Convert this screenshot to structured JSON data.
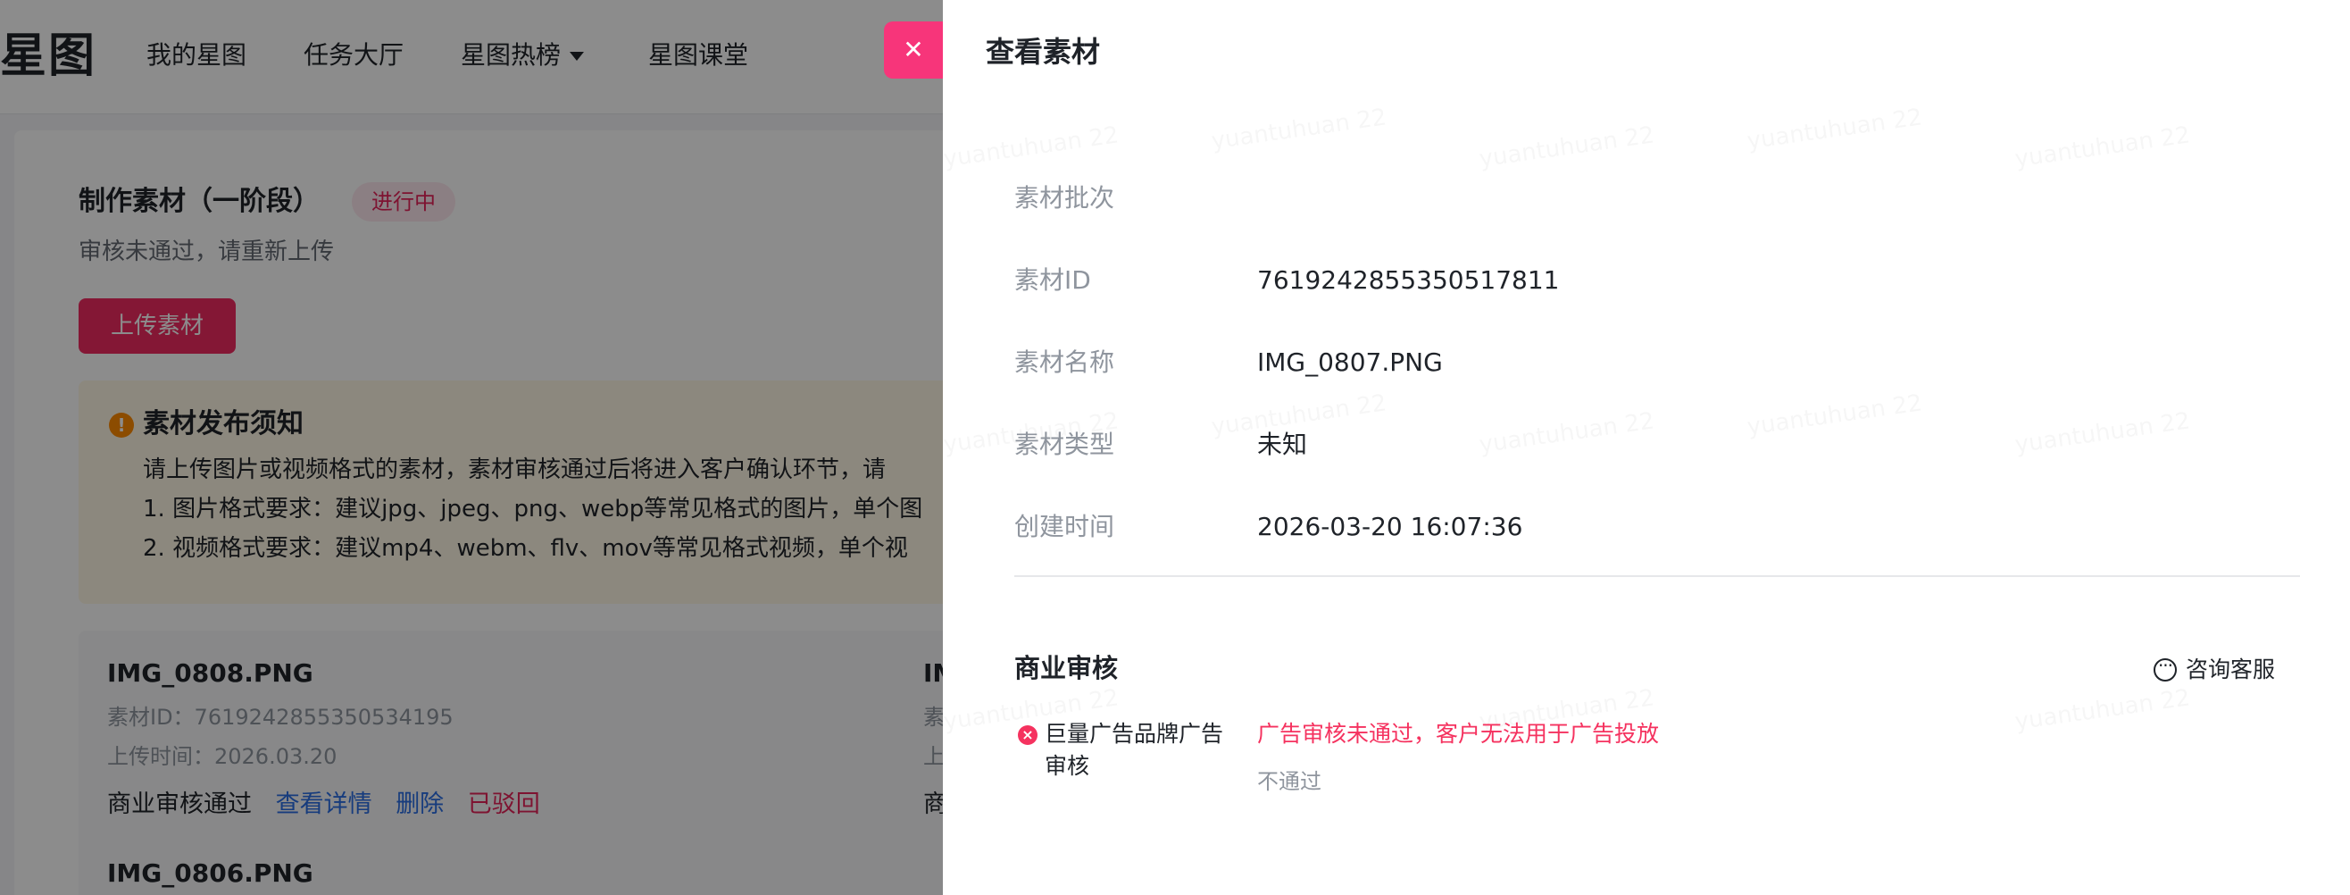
{
  "nav": {
    "logo": "星图",
    "items": [
      "我的星图",
      "任务大厅",
      "星图热榜",
      "星图课堂"
    ]
  },
  "stage": {
    "title": "制作素材（一阶段）",
    "status": "进行中",
    "subtitle": "审核未通过，请重新上传",
    "upload_button": "上传素材"
  },
  "notice": {
    "title": "素材发布须知",
    "lines": [
      "请上传图片或视频格式的素材，素材审核通过后将进入客户确认环节，请",
      "1. 图片格式要求：建议jpg、jpeg、png、webp等常见格式的图片，单个图",
      "2. 视频格式要求：建议mp4、webm、flv、mov等常见格式视频，单个视"
    ]
  },
  "materials": [
    {
      "name": "IMG_0808.PNG",
      "id_text": "素材ID：7619242855350534195",
      "time_text": "上传时间：2026.03.20",
      "status": "商业审核通过",
      "detail_link": "查看详情",
      "delete_link": "删除",
      "rejected": "已驳回"
    },
    {
      "name": "IMG_0806.PNG"
    }
  ],
  "right_peek": {
    "name_fragment": "IM",
    "meta_fragment_1": "素",
    "meta_fragment_2": "上",
    "status_fragment": "商"
  },
  "drawer": {
    "title": "查看素材",
    "close_glyph": "✕",
    "info": [
      {
        "label": "素材批次",
        "value": ""
      },
      {
        "label": "素材ID",
        "value": "7619242855350517811"
      },
      {
        "label": "素材名称",
        "value": "IMG_0807.PNG"
      },
      {
        "label": "素材类型",
        "value": "未知"
      },
      {
        "label": "创建时间",
        "value": "2026-03-20 16:07:36"
      }
    ],
    "review": {
      "title": "商业审核",
      "consult": "咨询客服",
      "item_name": "巨量广告品牌广告审核",
      "message": "广告审核未通过，客户无法用于广告投放",
      "result": "不通过"
    },
    "watermark_text": "yuantuhuan 22"
  },
  "colors": {
    "brand": "#f02a62",
    "danger": "#f5325f",
    "link": "#2a6de3",
    "warning": "#ff8a00"
  },
  "icons": {
    "close": "close-icon",
    "notice": "warning-icon",
    "caret": "caret-down-icon",
    "consult": "chat-bubble-icon",
    "fail": "error-circle-icon"
  }
}
